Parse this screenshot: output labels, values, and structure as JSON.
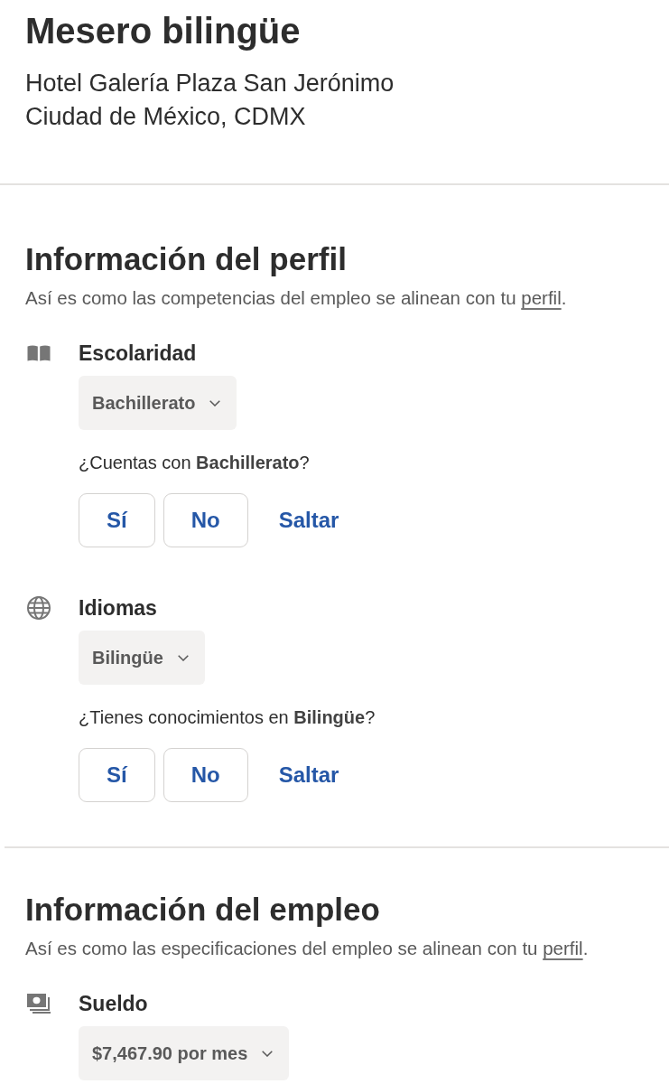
{
  "job": {
    "title": "Mesero bilingüe",
    "company": "Hotel Galería Plaza San Jerónimo",
    "location": "Ciudad de México, CDMX"
  },
  "sections": [
    {
      "heading": "Información del perfil",
      "subtitle": {
        "before": "Así es como las competencias del empleo se alinean con tu",
        "link": "perfil",
        "after": "."
      },
      "items": [
        {
          "kind": "education",
          "label": "Escolaridad",
          "dropdown": "Bachillerato",
          "question": "¿Cuentas con **Bachillerato**?",
          "answers": [
            {
              "kind": "outlined",
              "label": "Sí",
              "selected": false
            },
            {
              "kind": "outlined",
              "label": "No",
              "selected": false
            },
            {
              "kind": "text",
              "label": "Saltar",
              "selected": false
            }
          ]
        },
        {
          "kind": "language",
          "label": "Idiomas",
          "dropdown": "Bilingüe",
          "question": "¿Tienes conocimientos en **Bilingüe**?",
          "answers": [
            {
              "kind": "outlined",
              "label": "Sí",
              "selected": false
            },
            {
              "kind": "outlined",
              "label": "No",
              "selected": false
            },
            {
              "kind": "text",
              "label": "Saltar",
              "selected": false
            }
          ]
        }
      ]
    },
    {
      "heading": "Información del empleo",
      "subtitle": {
        "before": "Así es como las especificaciones del empleo se alinean con tu",
        "link": "perfil",
        "after": "."
      },
      "items": [
        {
          "kind": "salary",
          "label": "Sueldo",
          "dropdown": "$7,467.90 por mes"
        }
      ]
    }
  ]
}
